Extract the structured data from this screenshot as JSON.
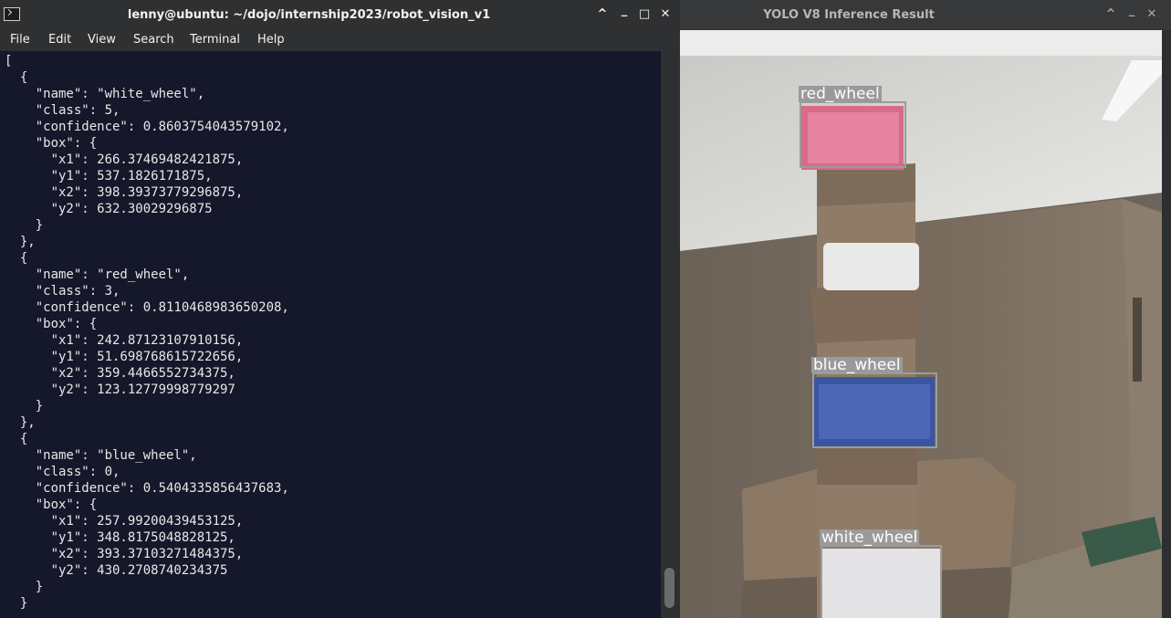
{
  "terminal": {
    "title": "lenny@ubuntu: ~/dojo/internship2023/robot_vision_v1",
    "menu": [
      "File",
      "Edit",
      "View",
      "Search",
      "Terminal",
      "Help"
    ],
    "output_lines": [
      "[",
      "  {",
      "    \"name\": \"white_wheel\",",
      "    \"class\": 5,",
      "    \"confidence\": 0.8603754043579102,",
      "    \"box\": {",
      "      \"x1\": 266.37469482421875,",
      "      \"y1\": 537.1826171875,",
      "      \"x2\": 398.39373779296875,",
      "      \"y2\": 632.30029296875",
      "    }",
      "  },",
      "  {",
      "    \"name\": \"red_wheel\",",
      "    \"class\": 3,",
      "    \"confidence\": 0.8110468983650208,",
      "    \"box\": {",
      "      \"x1\": 242.87123107910156,",
      "      \"y1\": 51.698768615722656,",
      "      \"x2\": 359.4466552734375,",
      "      \"y2\": 123.12779998779297",
      "    }",
      "  },",
      "  {",
      "    \"name\": \"blue_wheel\",",
      "    \"class\": 0,",
      "    \"confidence\": 0.5404335856437683,",
      "    \"box\": {",
      "      \"x1\": 257.99200439453125,",
      "      \"y1\": 348.8175048828125,",
      "      \"x2\": 393.37103271484375,",
      "      \"y2\": 430.2708740234375",
      "    }",
      "  }"
    ],
    "window_buttons": {
      "up": "^",
      "minimize": "_",
      "maximize": "□",
      "close": "✕"
    }
  },
  "yolo": {
    "title": "YOLO V8 Inference Result",
    "window_buttons": {
      "up": "^",
      "minimize": "_",
      "close": "✕"
    },
    "detections": [
      {
        "label": "red_wheel"
      },
      {
        "label": "blue_wheel"
      },
      {
        "label": "white_wheel"
      }
    ]
  },
  "icons": {
    "terminal_app": "terminal-icon",
    "chevron_up": "chevron-up-icon",
    "minimize": "minimize-icon",
    "maximize": "maximize-icon",
    "close": "close-icon"
  },
  "colors": {
    "terminal_bg": "#15172a",
    "titlebar_bg": "#2f3032",
    "label_bg": "#9a9a9a",
    "box_border": "#9c9c9c"
  }
}
